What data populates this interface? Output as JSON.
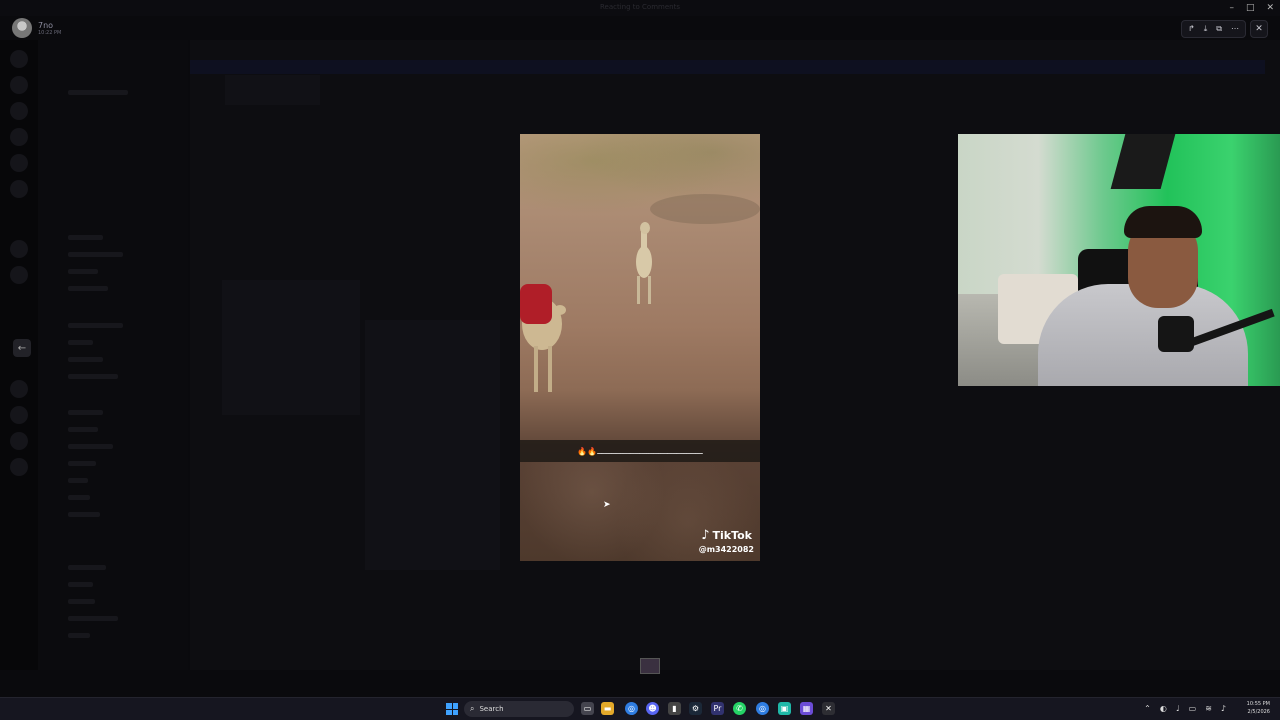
{
  "window": {
    "title": "Reacting to Comments"
  },
  "user": {
    "name": "7no",
    "time": "10:22 PM"
  },
  "viewer_toolbar": {
    "icons": [
      "share-icon",
      "download-icon",
      "open-external-icon",
      "more-icon"
    ],
    "close_icon": "close-icon",
    "back_icon": "arrow-left-icon"
  },
  "window_controls": {
    "minimize": "–",
    "maximize": "□",
    "close": "✕"
  },
  "video": {
    "platform": "TikTok",
    "handle": "@m3422082",
    "subtitle": "🔥🔥ـــــــــــــــــــــــــــــــــــــــــــــ"
  },
  "taskbar": {
    "search_label": "Search",
    "time": "10:55 PM",
    "date": "2/5/2026",
    "accent": "#3fa2ff"
  }
}
